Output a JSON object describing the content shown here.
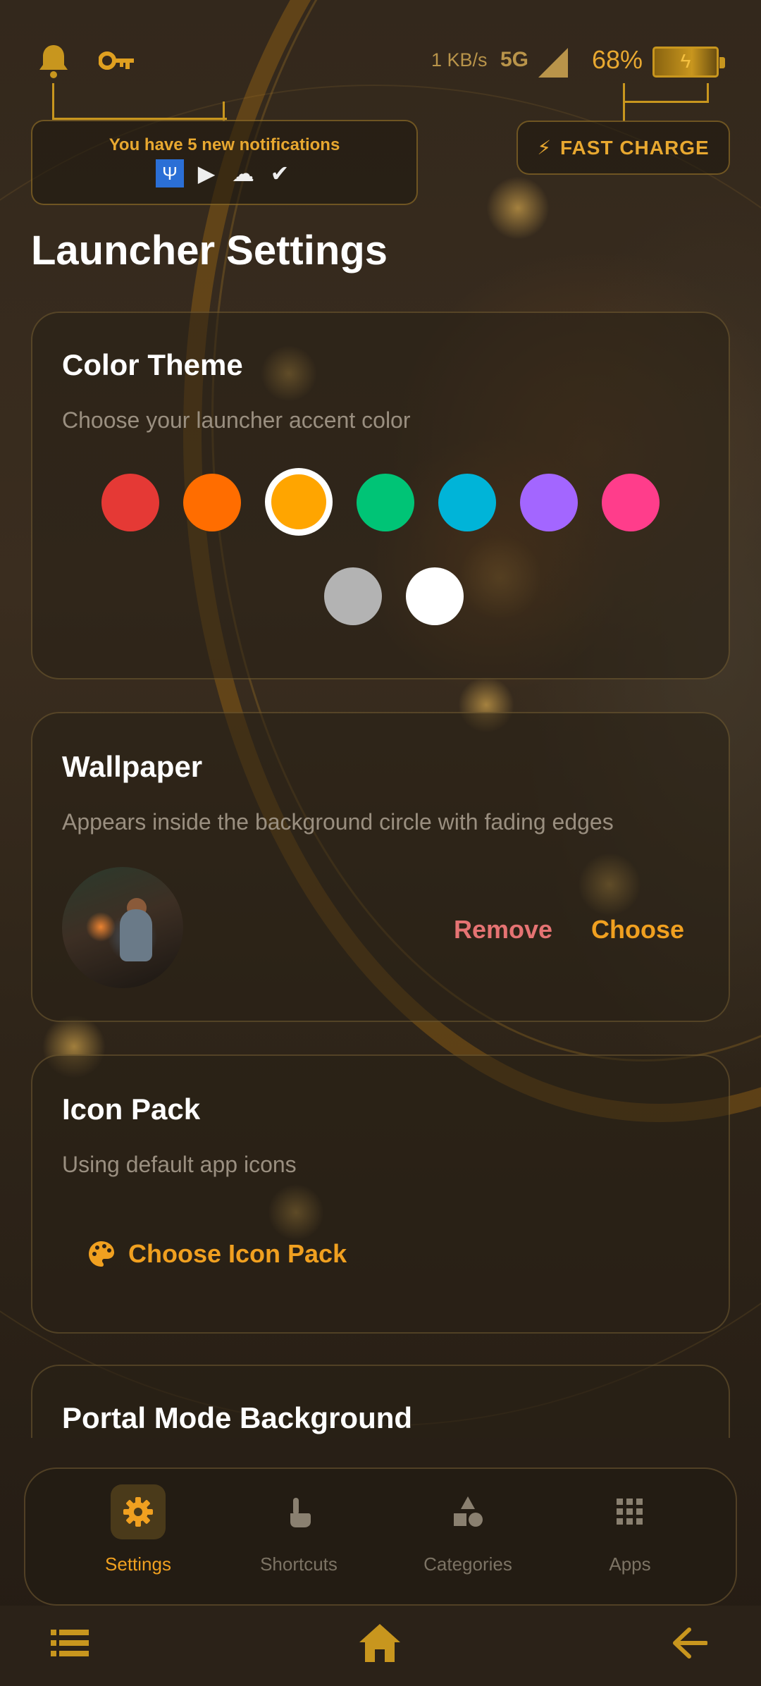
{
  "status_bar": {
    "speed": "1 KB/s",
    "network": "5G",
    "battery_percent": "68%",
    "battery_level": 0.68,
    "icons": [
      "bell-icon",
      "key-icon",
      "signal-icon",
      "battery-charging-icon"
    ]
  },
  "notifications": {
    "text": "You have 5 new notifications",
    "icons": [
      "usb-icon",
      "play-store-icon",
      "cloud-icon",
      "check-app-icon"
    ]
  },
  "fast_charge": {
    "label": "FAST CHARGE",
    "icon": "lightning-icon"
  },
  "page": {
    "title": "Launcher Settings"
  },
  "color_theme": {
    "title": "Color Theme",
    "description": "Choose your launcher accent color",
    "selected_color": "#FFA500",
    "colors": [
      "#E53935",
      "#FF6D00",
      "#FFA500",
      "#00C476",
      "#00B4D8",
      "#A366FF",
      "#FF3D8B",
      "#B3B3B3",
      "#FFFFFF"
    ]
  },
  "wallpaper": {
    "title": "Wallpaper",
    "description": "Appears inside the background circle with fading edges",
    "remove_label": "Remove",
    "choose_label": "Choose",
    "remove_color": "#E57373",
    "choose_color": "#F0A020"
  },
  "icon_pack": {
    "title": "Icon Pack",
    "description": "Using default app icons",
    "button_label": "Choose Icon Pack",
    "button_icon": "palette-icon"
  },
  "portal_mode": {
    "title": "Portal Mode Background"
  },
  "bottom_nav": {
    "items": [
      {
        "label": "Settings",
        "icon": "gear-icon",
        "active": true
      },
      {
        "label": "Shortcuts",
        "icon": "touch-icon",
        "active": false
      },
      {
        "label": "Categories",
        "icon": "shapes-icon",
        "active": false
      },
      {
        "label": "Apps",
        "icon": "grid-icon",
        "active": false
      }
    ]
  },
  "system_nav": {
    "icons": [
      "menu-list-icon",
      "home-icon",
      "back-arrow-icon"
    ]
  },
  "accent_color": "#F0A020"
}
